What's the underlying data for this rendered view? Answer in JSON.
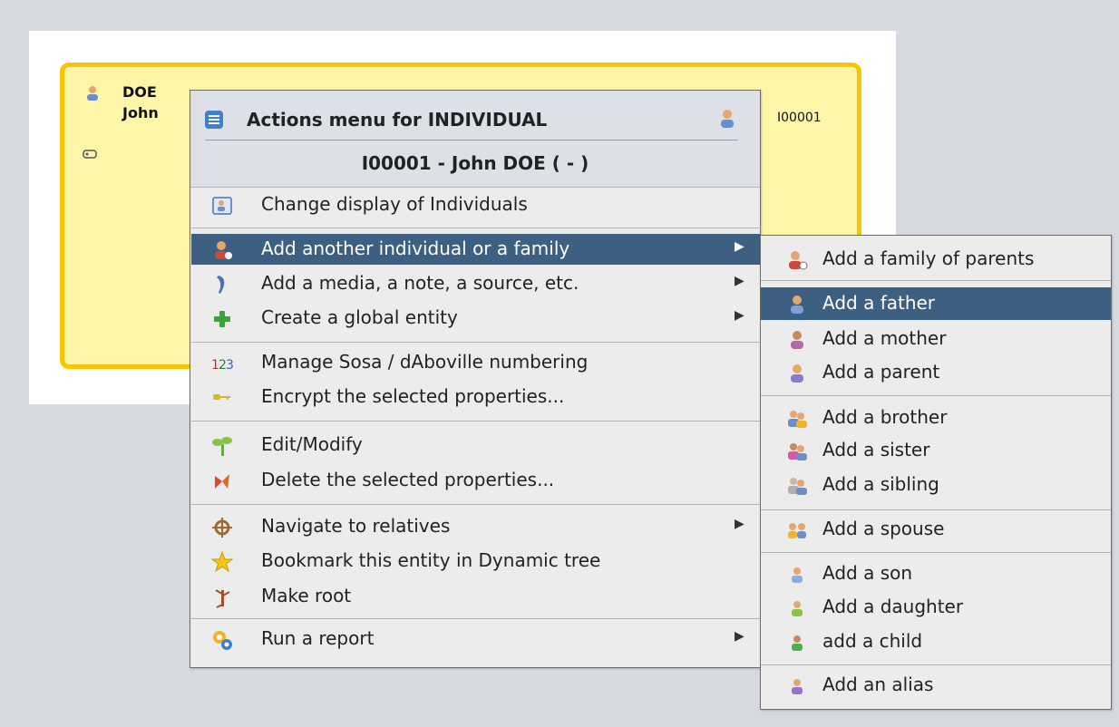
{
  "card": {
    "surname": "DOE",
    "given_name": "John",
    "id": "I00001",
    "flag_icon": "id-tag-icon"
  },
  "menu": {
    "title": "Actions menu for INDIVIDUAL",
    "subtitle": "I00001 - John DOE ( - )",
    "items": [
      {
        "label": "Change display of Individuals",
        "icon": "display-icon",
        "submenu": false
      },
      {
        "label": "Add another individual or a family",
        "icon": "add-person-icon",
        "submenu": true,
        "highlighted": true
      },
      {
        "label": "Add a media, a note, a source, etc.",
        "icon": "quill-icon",
        "submenu": true
      },
      {
        "label": "Create a global entity",
        "icon": "plus-icon",
        "submenu": true
      },
      {
        "label": "Manage Sosa / dAboville numbering",
        "icon": "numbering-icon",
        "submenu": false
      },
      {
        "label": "Encrypt the selected properties...",
        "icon": "key-icon",
        "submenu": false
      },
      {
        "label": "Edit/Modify",
        "icon": "sprout-icon",
        "submenu": false
      },
      {
        "label": "Delete the selected properties...",
        "icon": "delete-icon",
        "submenu": false
      },
      {
        "label": "Navigate to relatives",
        "icon": "helm-icon",
        "submenu": true
      },
      {
        "label": "Bookmark this entity in Dynamic tree",
        "icon": "star-icon",
        "submenu": false
      },
      {
        "label": "Make root",
        "icon": "root-icon",
        "submenu": false
      },
      {
        "label": "Run a report",
        "icon": "report-icon",
        "submenu": true
      }
    ]
  },
  "submenu": {
    "items": [
      {
        "label": "Add a family of parents",
        "icon": "family-icon"
      },
      {
        "label": "Add a father",
        "icon": "father-icon",
        "highlighted": true
      },
      {
        "label": "Add a mother",
        "icon": "mother-icon"
      },
      {
        "label": "Add a parent",
        "icon": "parent-icon"
      },
      {
        "label": "Add a brother",
        "icon": "brother-icon"
      },
      {
        "label": "Add a sister",
        "icon": "sister-icon"
      },
      {
        "label": "Add a sibling",
        "icon": "sibling-icon"
      },
      {
        "label": "Add a spouse",
        "icon": "spouse-icon"
      },
      {
        "label": "Add a son",
        "icon": "son-icon"
      },
      {
        "label": "Add a daughter",
        "icon": "daughter-icon"
      },
      {
        "label": "add a child",
        "icon": "child-icon"
      },
      {
        "label": "Add an alias",
        "icon": "alias-icon"
      }
    ]
  },
  "colors": {
    "highlight": "#3c5f82",
    "card_bg": "#fdf6a8",
    "card_border": "#f7c600"
  }
}
